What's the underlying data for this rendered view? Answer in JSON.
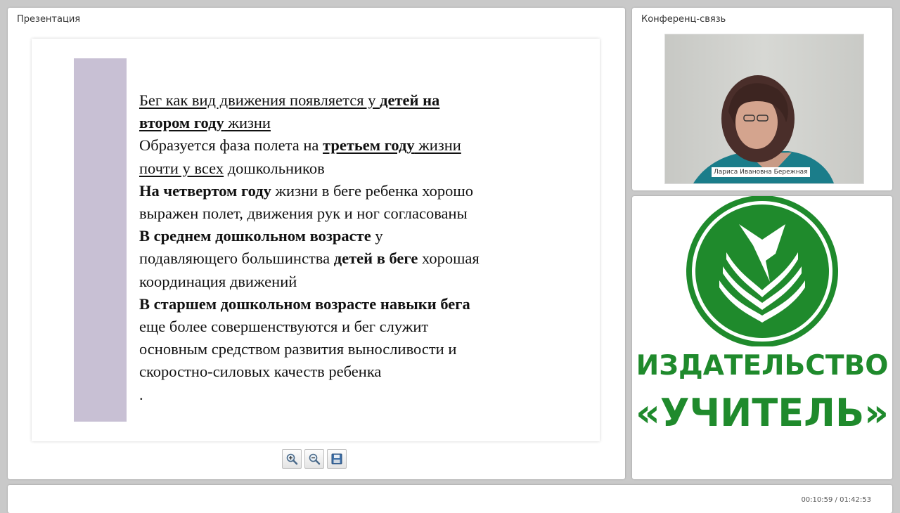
{
  "presentation": {
    "title": "Презентация",
    "lines": [
      {
        "parts": [
          {
            "t": "Бег как вид движения появляется у ",
            "u": true
          },
          {
            "t": "детей на",
            "u": true,
            "b": true
          }
        ]
      },
      {
        "parts": [
          {
            "t": "втором году",
            "u": true,
            "b": true
          },
          {
            "t": " жизни",
            "u": true
          }
        ]
      },
      {
        "parts": [
          {
            "t": "Образуется фаза полета  на "
          },
          {
            "t": "третьем году",
            "u": true,
            "b": true
          },
          {
            "t": " жизни",
            "u": true
          }
        ]
      },
      {
        "parts": [
          {
            "t": "почти у всех",
            "u": true
          },
          {
            "t": " дошкольников"
          }
        ]
      },
      {
        "parts": [
          {
            "t": "На четвертом году",
            "b": true
          },
          {
            "t": " жизни в беге ребенка хорошо"
          }
        ]
      },
      {
        "parts": [
          {
            "t": "выражен полет, движения рук и ног согласованы"
          }
        ]
      },
      {
        "parts": [
          {
            "t": "В среднем дошкольном возрасте",
            "b": true
          },
          {
            "t": "  у"
          }
        ]
      },
      {
        "parts": [
          {
            "t": "подавляющего большинства "
          },
          {
            "t": "детей в беге",
            "b": true
          },
          {
            "t": " хорошая"
          }
        ]
      },
      {
        "parts": [
          {
            "t": "координация движений"
          }
        ]
      },
      {
        "parts": [
          {
            "t": "В старшем дошкольном возрасте навыки бега",
            "b": true
          }
        ]
      },
      {
        "parts": [
          {
            "t": "еще более совершенствуются и  бег служит"
          }
        ]
      },
      {
        "parts": [
          {
            "t": "основным средством развития выносливости и"
          }
        ]
      },
      {
        "parts": [
          {
            "t": "скоростно-силовых качеств ребенка"
          }
        ]
      },
      {
        "parts": [
          {
            "t": "."
          }
        ]
      }
    ],
    "toolbar": [
      "zoom-in-icon",
      "zoom-out-icon",
      "save-icon"
    ]
  },
  "conference": {
    "title": "Конференц-связь",
    "participant_name": "Лариса Ивановна Бережная"
  },
  "publisher": {
    "line1": "ИЗДАТЕЛЬСТВО",
    "line2": "«УЧИТЕЛЬ»"
  },
  "player": {
    "time": "00:10:59 / 01:42:53"
  },
  "colors": {
    "brand_green": "#1f8a2c",
    "slide_bar": "#c8c0d4",
    "background": "#c9c9c9"
  }
}
